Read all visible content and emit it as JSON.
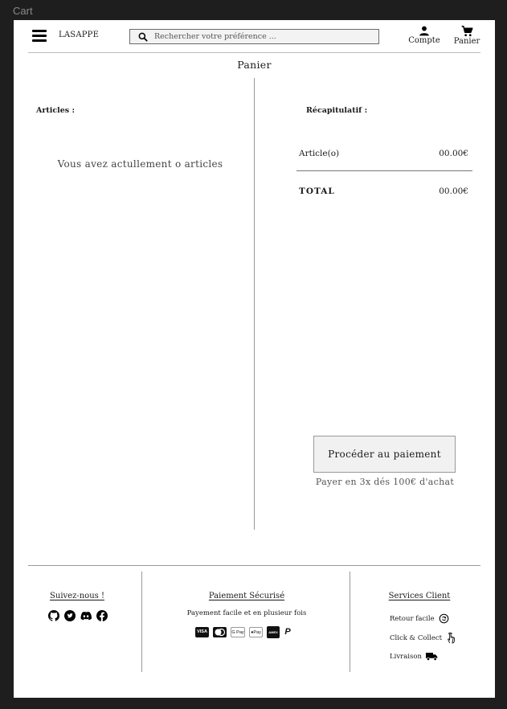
{
  "frame": {
    "label": "Cart"
  },
  "header": {
    "brand": "LASAPPE",
    "search_placeholder": "Rechercher votre préférence ...",
    "account_label": "Compte",
    "cart_label": "Panier"
  },
  "page": {
    "title": "Panier"
  },
  "articles": {
    "title": "Articles :",
    "empty_message": "Vous avez actullement o articles"
  },
  "summary": {
    "title": "Récapitulatif :",
    "articles_label": "Article(o)",
    "articles_value": "00.00€",
    "total_label": "TOTAL",
    "total_value": "00.00€"
  },
  "checkout": {
    "button_label": "Procéder au paiement",
    "note": "Payer en 3x dés 100€ d'achat"
  },
  "footer": {
    "social": {
      "title": "Suivez-nous !",
      "icons": [
        "github-icon",
        "twitter-icon",
        "discord-icon",
        "facebook-icon"
      ]
    },
    "secure_payment": {
      "title": "Paiement Sécurisé",
      "subtitle": "Payement facile et en plusieur fois",
      "methods": [
        "visa",
        "mastercard",
        "google-pay",
        "apple-pay",
        "american-express",
        "paypal"
      ]
    },
    "services": {
      "title": "Services Client",
      "items": [
        {
          "label": "Retour facile",
          "icon": "return-icon"
        },
        {
          "label": "Click & Collect",
          "icon": "hand-pointer-icon"
        },
        {
          "label": "Livraison",
          "icon": "truck-icon"
        }
      ]
    }
  }
}
